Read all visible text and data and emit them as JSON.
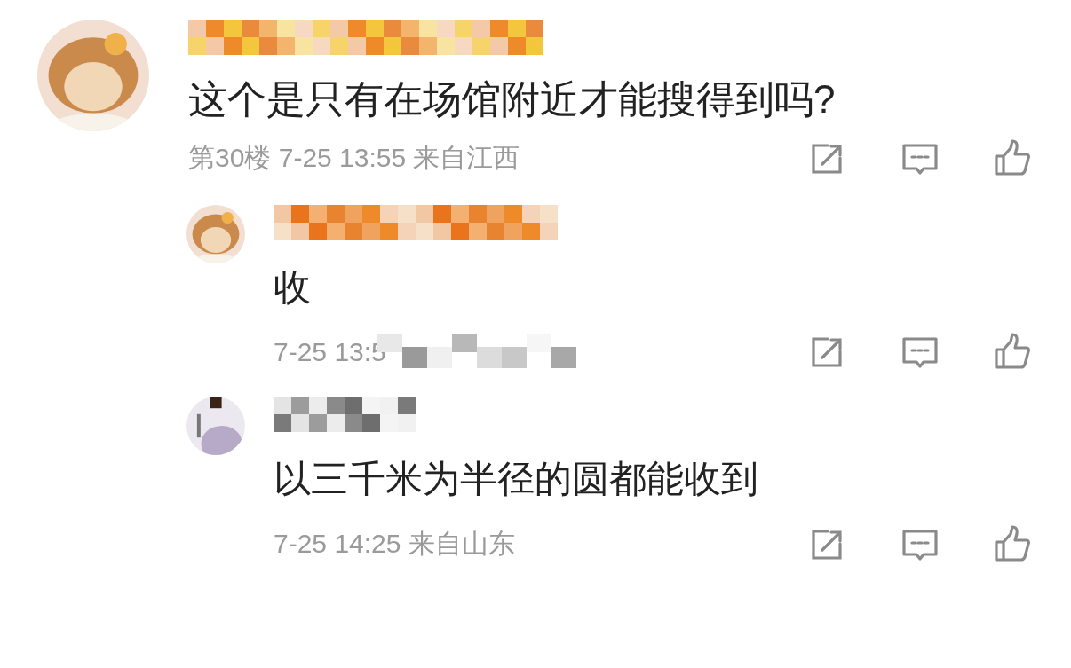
{
  "comment": {
    "text": "这个是只有在场馆附近才能搜得到吗?",
    "meta": "第30楼 7-25 13:55 来自江西",
    "replies": [
      {
        "text": "收",
        "meta": "7-25 13:5",
        "meta_obscured": true
      },
      {
        "text": "以三千米为半径的圆都能收到",
        "meta": "7-25 14:25 来自山东",
        "meta_obscured": false
      }
    ]
  }
}
